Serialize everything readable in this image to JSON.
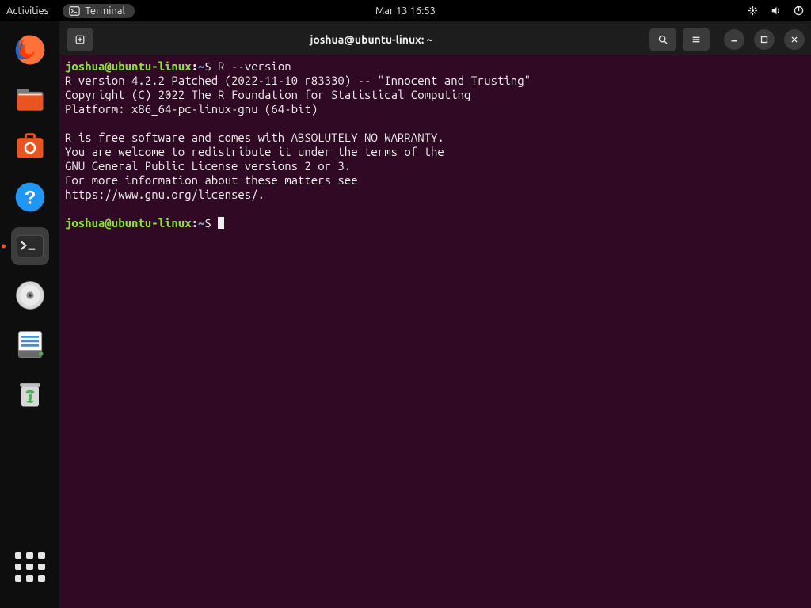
{
  "panel": {
    "activities": "Activities",
    "app_name": "Terminal",
    "clock": "Mar 13  16:53"
  },
  "window": {
    "title": "joshua@ubuntu-linux: ~"
  },
  "prompt": {
    "userhost": "joshua@ubuntu-linux",
    "sep": ":",
    "path": "~",
    "symbol": "$"
  },
  "session": {
    "command": "R --version",
    "output": [
      "R version 4.2.2 Patched (2022-11-10 r83330) -- \"Innocent and Trusting\"",
      "Copyright (C) 2022 The R Foundation for Statistical Computing",
      "Platform: x86_64-pc-linux-gnu (64-bit)",
      "",
      "R is free software and comes with ABSOLUTELY NO WARRANTY.",
      "You are welcome to redistribute it under the terms of the",
      "GNU General Public License versions 2 or 3.",
      "For more information about these matters see",
      "https://www.gnu.org/licenses/."
    ]
  },
  "dock": {
    "items": [
      "firefox",
      "files",
      "software",
      "help",
      "terminal",
      "disk",
      "text-editor",
      "trash"
    ]
  }
}
